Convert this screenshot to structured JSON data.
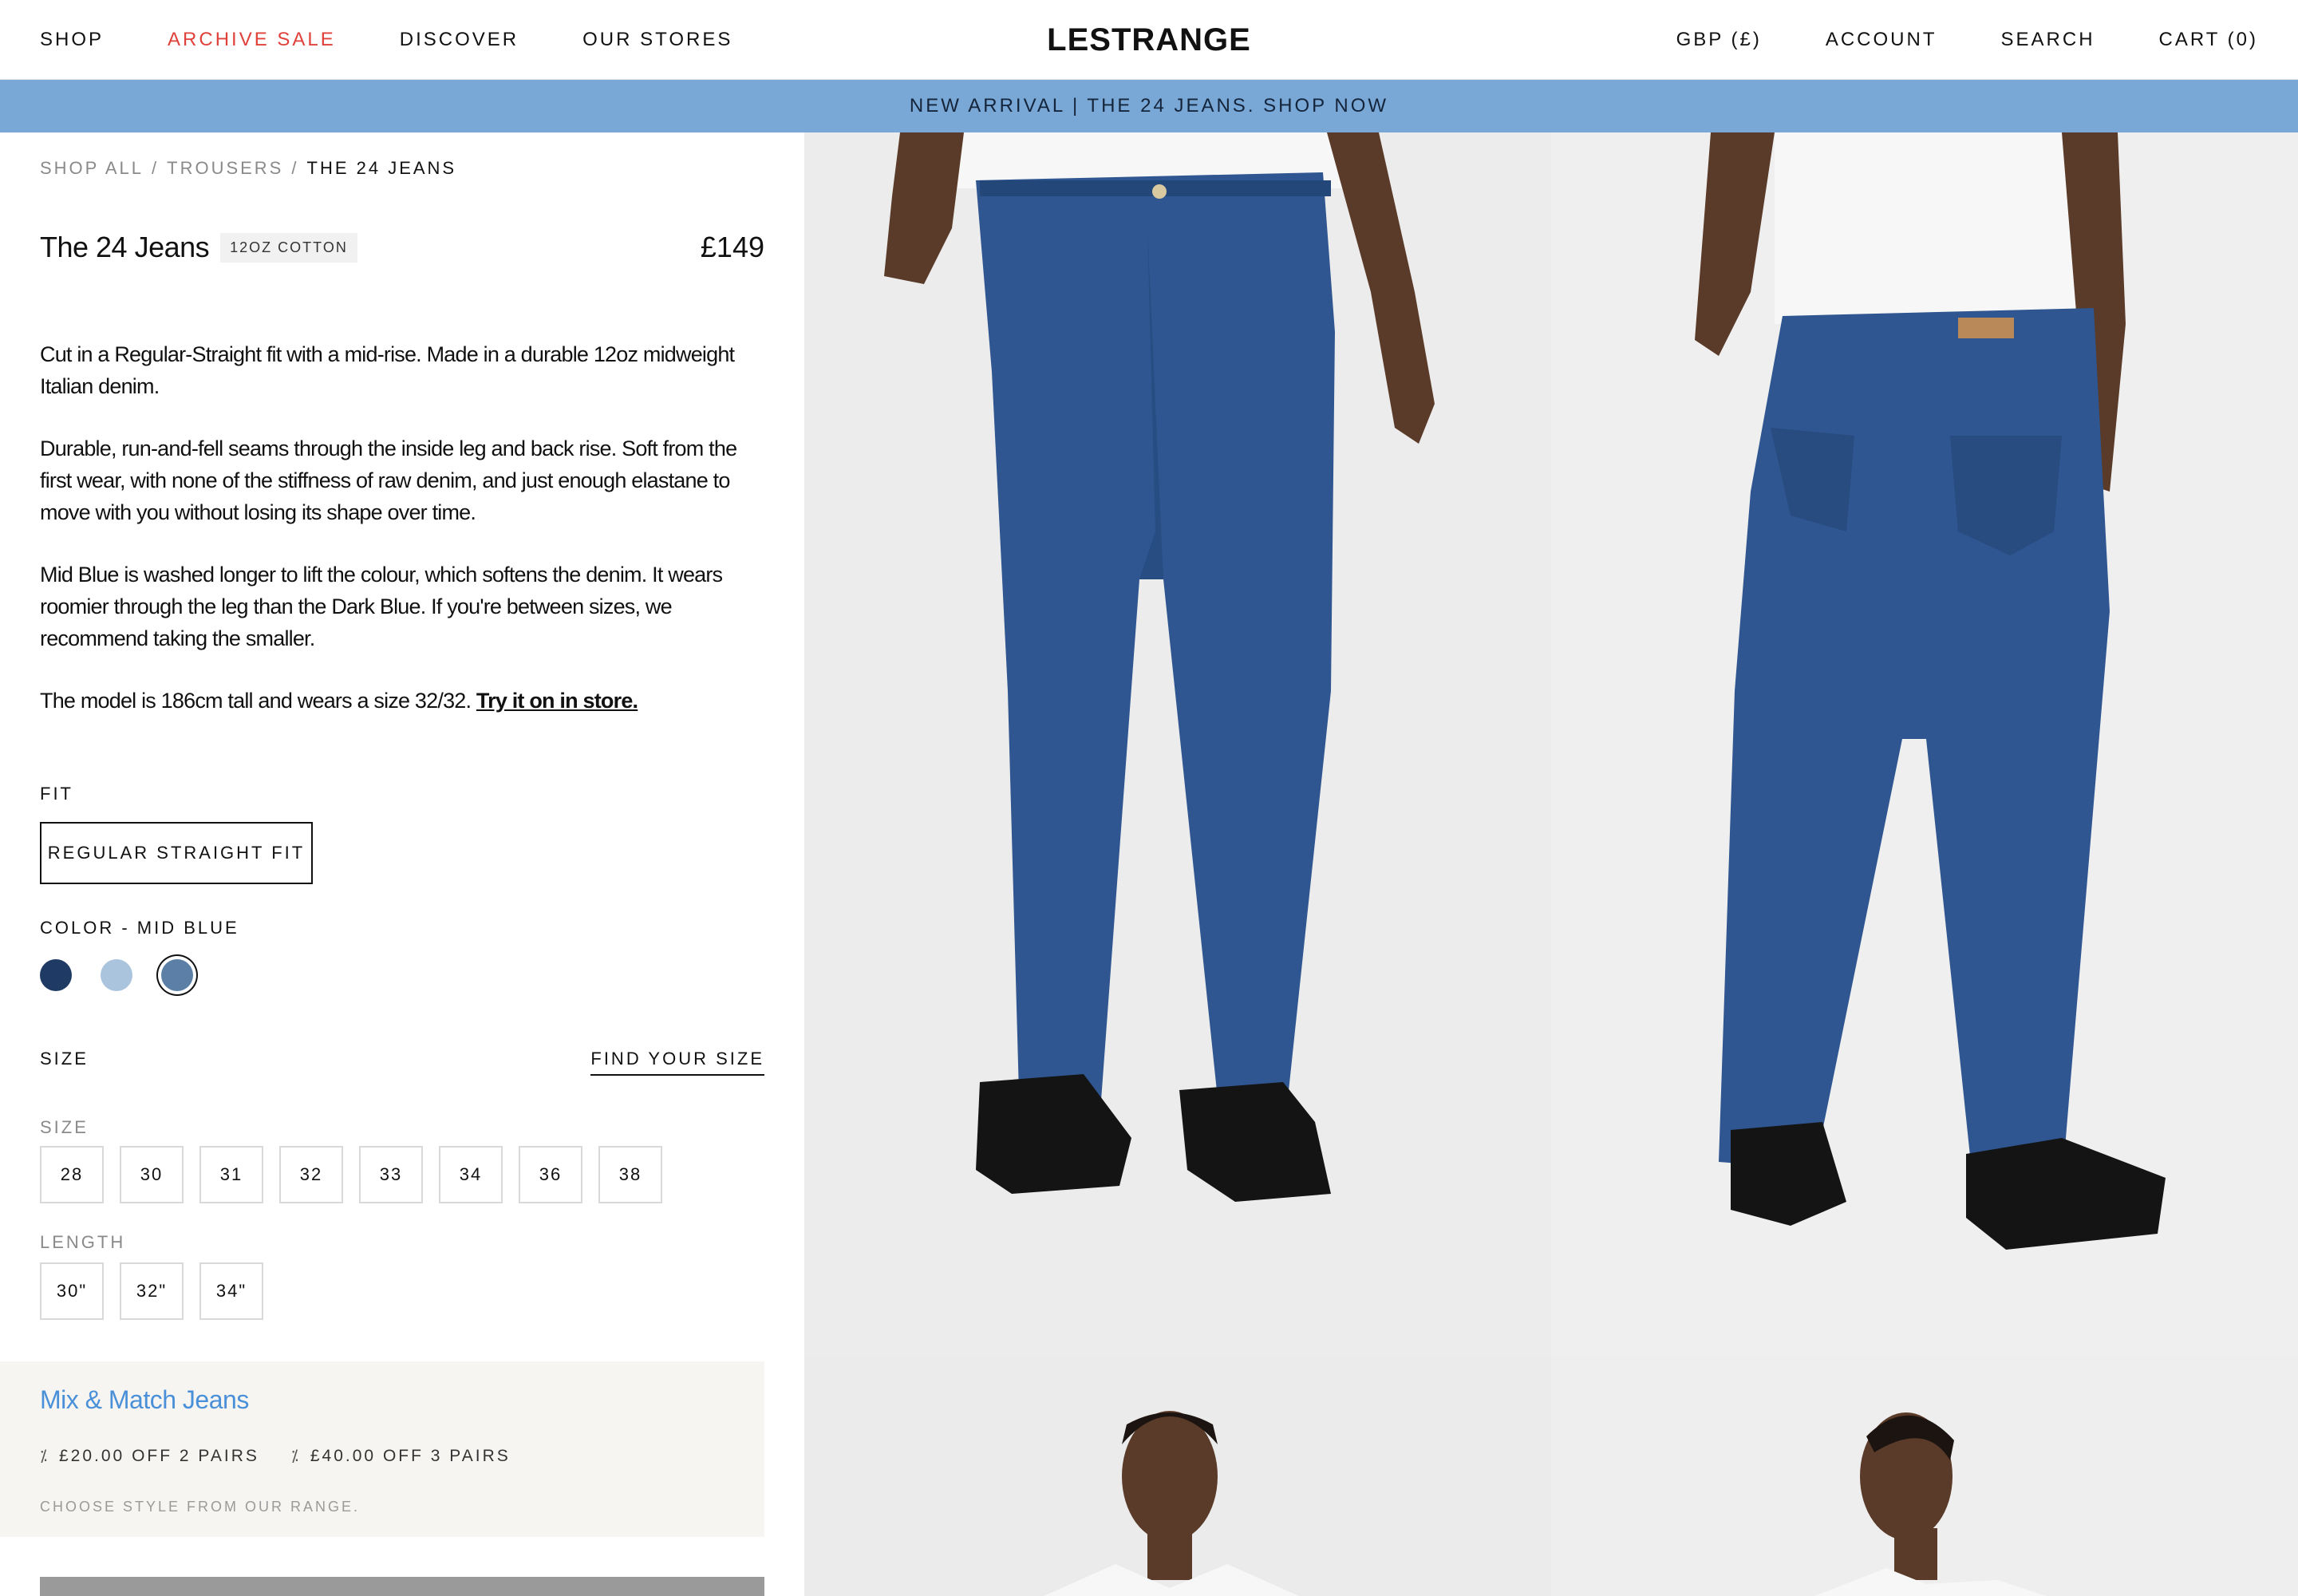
{
  "header": {
    "nav_left": [
      "SHOP",
      "ARCHIVE SALE",
      "DISCOVER",
      "OUR STORES"
    ],
    "logo": "LESTRANGE",
    "nav_right": [
      "GBP (£)",
      "ACCOUNT",
      "SEARCH",
      "CART (0)"
    ],
    "sale_color": "#e0413a"
  },
  "banner": {
    "text": "NEW ARRIVAL | THE 24 JEANS. SHOP NOW",
    "color": "#79a7d6"
  },
  "breadcrumb": {
    "shop_all": "SHOP ALL",
    "sep1": "/",
    "trousers": "TROUSERS",
    "sep2": "/",
    "current": "THE 24 JEANS"
  },
  "product": {
    "title": "The 24 Jeans",
    "tag": "12OZ COTTON",
    "price": "£149",
    "desc": [
      "Cut in a Regular-Straight fit with a mid-rise. Made in a durable 12oz midweight Italian denim.",
      "Durable, run-and-fell seams through the inside leg and back rise. Soft from the first wear, with none of the stiffness of raw denim, and just enough elastane to move with you without losing its shape over time.",
      "Mid Blue is washed longer to lift the colour, which softens the denim. It wears roomier through the leg than the Dark Blue. If you're between sizes, we recommend taking the smaller."
    ],
    "model_note": "The model is 186cm tall and wears a size 32/32.",
    "store_link": "Try it on in store."
  },
  "fit": {
    "label": "FIT",
    "option": "REGULAR STRAIGHT FIT"
  },
  "color": {
    "label": "COLOR - MID BLUE",
    "swatches": [
      {
        "name": "Dark Blue",
        "hex": "#1f3a64"
      },
      {
        "name": "Light Blue",
        "hex": "#a9c4dc"
      },
      {
        "name": "Mid Blue",
        "hex": "#5b7fa6",
        "selected": true
      }
    ]
  },
  "size": {
    "label": "SIZE",
    "find_size": "FIND YOUR SIZE",
    "size_label": "SIZE",
    "sizes": [
      "28",
      "30",
      "31",
      "32",
      "33",
      "34",
      "36",
      "38"
    ],
    "length_label": "LENGTH",
    "lengths": [
      "30\"",
      "32\"",
      "34\""
    ]
  },
  "promo": {
    "title": "Mix & Match Jeans",
    "offers": [
      "£20.00 OFF 2 PAIRS",
      "£40.00 OFF 3 PAIRS"
    ],
    "note": "CHOOSE STYLE FROM OUR RANGE.",
    "icon": "percent-icon",
    "title_color": "#4a90d9"
  },
  "gallery": {
    "denim_color": "#2f5690",
    "shirt_color": "#f7f7f7",
    "skin_color": "#5a3a28",
    "shoe_color": "#141414"
  }
}
